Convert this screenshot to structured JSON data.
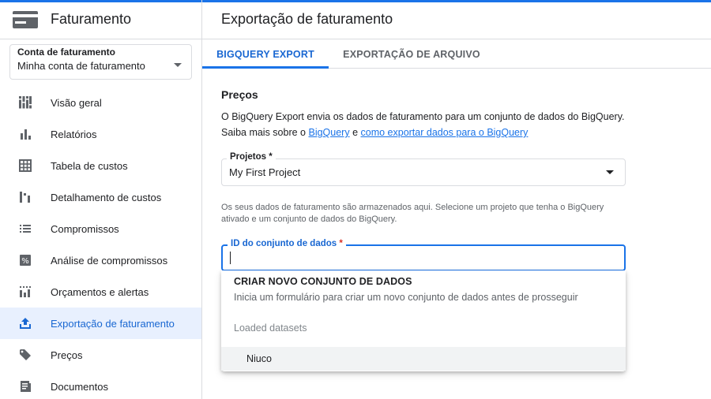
{
  "sidebar": {
    "app_title": "Faturamento",
    "account_select": {
      "label": "Conta de faturamento",
      "value": "Minha conta de faturamento"
    },
    "items": [
      {
        "label": "Visão geral",
        "icon": "overview-icon"
      },
      {
        "label": "Relatórios",
        "icon": "bar-chart-icon"
      },
      {
        "label": "Tabela de custos",
        "icon": "table-icon"
      },
      {
        "label": "Detalhamento de custos",
        "icon": "breakdown-icon"
      },
      {
        "label": "Compromissos",
        "icon": "list-icon"
      },
      {
        "label": "Análise de compromissos",
        "icon": "percent-icon"
      },
      {
        "label": "Orçamentos e alertas",
        "icon": "budget-icon"
      },
      {
        "label": "Exportação de faturamento",
        "icon": "upload-icon",
        "active": true
      },
      {
        "label": "Preços",
        "icon": "tag-icon"
      },
      {
        "label": "Documentos",
        "icon": "document-icon"
      }
    ]
  },
  "main": {
    "title": "Exportação de faturamento",
    "tabs": [
      {
        "label": "BIGQUERY EXPORT",
        "active": true
      },
      {
        "label": "EXPORTAÇÃO DE ARQUIVO",
        "active": false
      }
    ],
    "section_title": "Preços",
    "description_text": "O BigQuery Export envia os dados de faturamento para um conjunto de dados do BigQuery. Saiba mais sobre o ",
    "description_link1": "BigQuery",
    "description_and": " e ",
    "description_link2": "como exportar dados para o BigQuery",
    "project_field": {
      "label": "Projetos *",
      "value": "My First Project"
    },
    "hint": "Os seus dados de faturamento são armazenados aqui. Selecione um projeto que tenha o BigQuery ativado e um conjunto de dados do BigQuery.",
    "dataset_field": {
      "label": "ID do conjunto de dados",
      "required_mark": "*",
      "value": ""
    }
  },
  "dropdown": {
    "create_title": "CRIAR NOVO CONJUNTO DE DADOS",
    "create_subtitle": "Inicia um formulário para criar um novo conjunto de dados antes de prosseguir",
    "group_label": "Loaded datasets",
    "options": [
      "Niuco"
    ]
  },
  "colors": {
    "accent": "#1a73e8",
    "active_bg": "#e8f0fe",
    "required": "#d93025"
  }
}
